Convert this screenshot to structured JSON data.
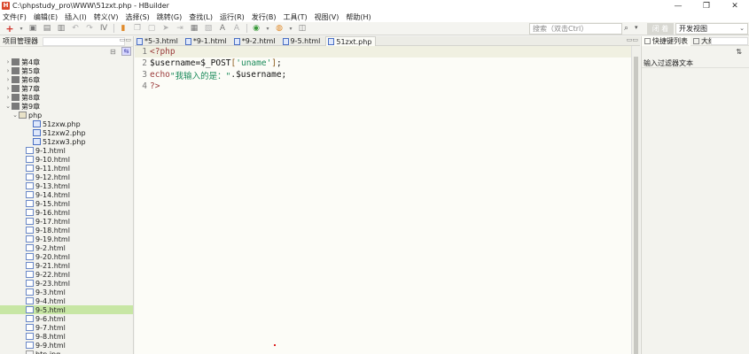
{
  "window": {
    "title": "C:\\phpstudy_pro\\WWW\\51zxt.php  -  HBuilder",
    "app_icon": "H",
    "controls": {
      "minimize": "—",
      "maximize": "❐",
      "close": "✕"
    }
  },
  "menu": [
    "文件(F)",
    "编辑(E)",
    "插入(I)",
    "转义(V)",
    "选择(S)",
    "跳转(G)",
    "查找(L)",
    "运行(R)",
    "发行(B)",
    "工具(T)",
    "视图(V)",
    "帮助(H)"
  ],
  "toolbar": {
    "search_placeholder": "搜索（双击Ctrl）",
    "search_icon": "🔍",
    "close_mode_label": "闭 着",
    "mode_select_value": "开发视图"
  },
  "project_panel": {
    "title": "项目管理器",
    "items": [
      {
        "type": "folder-cn",
        "label": "第4章",
        "indent": 0,
        "twisty": "›"
      },
      {
        "type": "folder-cn",
        "label": "第5章",
        "indent": 0,
        "twisty": "›"
      },
      {
        "type": "folder-cn",
        "label": "第6章",
        "indent": 0,
        "twisty": "›"
      },
      {
        "type": "folder-cn",
        "label": "第7章",
        "indent": 0,
        "twisty": "›"
      },
      {
        "type": "folder-cn",
        "label": "第8章",
        "indent": 0,
        "twisty": "›"
      },
      {
        "type": "folder-cn",
        "label": "第9章",
        "indent": 0,
        "twisty": "⌄"
      },
      {
        "type": "folder",
        "label": "php",
        "indent": 1,
        "twisty": "⌄"
      },
      {
        "type": "php",
        "label": "51zxw.php",
        "indent": 3,
        "twisty": ""
      },
      {
        "type": "php",
        "label": "51zxw2.php",
        "indent": 3,
        "twisty": ""
      },
      {
        "type": "php",
        "label": "51zxw3.php",
        "indent": 3,
        "twisty": ""
      },
      {
        "type": "html",
        "label": "9-1.html",
        "indent": 2,
        "twisty": ""
      },
      {
        "type": "html",
        "label": "9-10.html",
        "indent": 2,
        "twisty": ""
      },
      {
        "type": "html",
        "label": "9-11.html",
        "indent": 2,
        "twisty": ""
      },
      {
        "type": "html",
        "label": "9-12.html",
        "indent": 2,
        "twisty": ""
      },
      {
        "type": "html",
        "label": "9-13.html",
        "indent": 2,
        "twisty": ""
      },
      {
        "type": "html",
        "label": "9-14.html",
        "indent": 2,
        "twisty": ""
      },
      {
        "type": "html",
        "label": "9-15.html",
        "indent": 2,
        "twisty": ""
      },
      {
        "type": "html",
        "label": "9-16.html",
        "indent": 2,
        "twisty": ""
      },
      {
        "type": "html",
        "label": "9-17.html",
        "indent": 2,
        "twisty": ""
      },
      {
        "type": "html",
        "label": "9-18.html",
        "indent": 2,
        "twisty": ""
      },
      {
        "type": "html",
        "label": "9-19.html",
        "indent": 2,
        "twisty": ""
      },
      {
        "type": "html",
        "label": "9-2.html",
        "indent": 2,
        "twisty": ""
      },
      {
        "type": "html",
        "label": "9-20.html",
        "indent": 2,
        "twisty": ""
      },
      {
        "type": "html",
        "label": "9-21.html",
        "indent": 2,
        "twisty": ""
      },
      {
        "type": "html",
        "label": "9-22.html",
        "indent": 2,
        "twisty": ""
      },
      {
        "type": "html",
        "label": "9-23.html",
        "indent": 2,
        "twisty": ""
      },
      {
        "type": "html",
        "label": "9-3.html",
        "indent": 2,
        "twisty": ""
      },
      {
        "type": "html",
        "label": "9-4.html",
        "indent": 2,
        "twisty": ""
      },
      {
        "type": "html",
        "label": "9-5.html",
        "indent": 2,
        "twisty": "",
        "selected": true
      },
      {
        "type": "html",
        "label": "9-6.html",
        "indent": 2,
        "twisty": ""
      },
      {
        "type": "html",
        "label": "9-7.html",
        "indent": 2,
        "twisty": ""
      },
      {
        "type": "html",
        "label": "9-8.html",
        "indent": 2,
        "twisty": ""
      },
      {
        "type": "html",
        "label": "9-9.html",
        "indent": 2,
        "twisty": ""
      },
      {
        "type": "img",
        "label": "btn.jpg",
        "indent": 2,
        "twisty": ""
      }
    ]
  },
  "editor": {
    "tabs": [
      {
        "label": "*5-3.html",
        "active": false
      },
      {
        "label": "*9-1.html",
        "active": false
      },
      {
        "label": "*9-2.html",
        "active": false
      },
      {
        "label": "9-5.html",
        "active": false
      },
      {
        "label": "51zxt.php",
        "active": true
      }
    ],
    "lines": [
      {
        "num": "1",
        "tokens": [
          {
            "c": "k-tag",
            "t": "<?php"
          }
        ],
        "current": true
      },
      {
        "num": "2",
        "tokens": [
          {
            "c": "k-var",
            "t": "$username=$_POST"
          },
          {
            "c": "k-br",
            "t": "["
          },
          {
            "c": "k-str",
            "t": "'uname'"
          },
          {
            "c": "k-br",
            "t": "]"
          },
          {
            "c": "k-var",
            "t": ";"
          }
        ]
      },
      {
        "num": "3",
        "tokens": [
          {
            "c": "k-kw",
            "t": "echo"
          },
          {
            "c": "k-str",
            "t": "\"我输入的是：\""
          },
          {
            "c": "k-var",
            "t": ".$username;"
          }
        ]
      },
      {
        "num": "4",
        "tokens": [
          {
            "c": "k-tag",
            "t": "?>"
          }
        ]
      }
    ]
  },
  "right_panel": {
    "tabs": [
      "快捷键列表",
      "大纲"
    ],
    "filter_label": "输入过滤器文本",
    "sort_icon": "⇅"
  }
}
